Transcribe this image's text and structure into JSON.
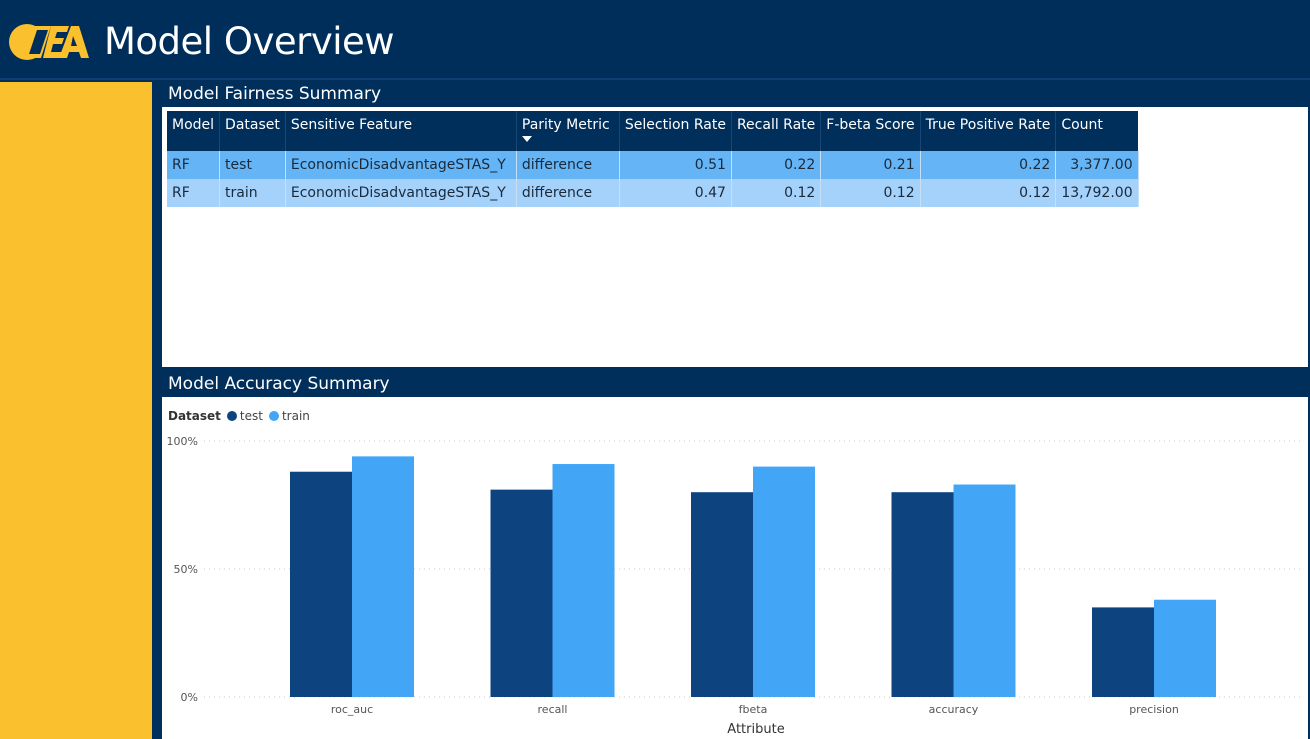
{
  "header": {
    "title": "Model Overview",
    "logo_text": "CEA"
  },
  "colors": {
    "navy": "#002f5c",
    "sidebar": "#fbc02d",
    "test": "#0d4480",
    "train": "#42a5f5",
    "row_a": "#64b4f6",
    "row_b": "#a5d2fb"
  },
  "fairness": {
    "title": "Model Fairness Summary",
    "columns": [
      "Model",
      "Dataset",
      "Sensitive Feature",
      "Parity Metric",
      "Selection Rate",
      "Recall Rate",
      "F-beta Score",
      "True Positive Rate",
      "Count"
    ],
    "rows": [
      [
        "RF",
        "test",
        "EconomicDisadvantageSTAS_Y",
        "difference",
        "0.51",
        "0.22",
        "0.21",
        "0.22",
        "3,377.00"
      ],
      [
        "RF",
        "train",
        "EconomicDisadvantageSTAS_Y",
        "difference",
        "0.47",
        "0.12",
        "0.12",
        "0.12",
        "13,792.00"
      ]
    ]
  },
  "accuracy": {
    "title": "Model Accuracy Summary",
    "legend_title": "Dataset"
  },
  "chart_data": {
    "type": "bar",
    "categories": [
      "roc_auc",
      "recall",
      "fbeta",
      "accuracy",
      "precision"
    ],
    "series": [
      {
        "name": "test",
        "values": [
          88,
          81,
          80,
          80,
          35
        ]
      },
      {
        "name": "train",
        "values": [
          94,
          91,
          90,
          83,
          38
        ]
      }
    ],
    "xlabel": "Attribute",
    "ylabel": "",
    "ylim": [
      0,
      100
    ],
    "y_ticks": [
      "0%",
      "50%",
      "100%"
    ],
    "grid": true,
    "legend_position": "top-left"
  }
}
